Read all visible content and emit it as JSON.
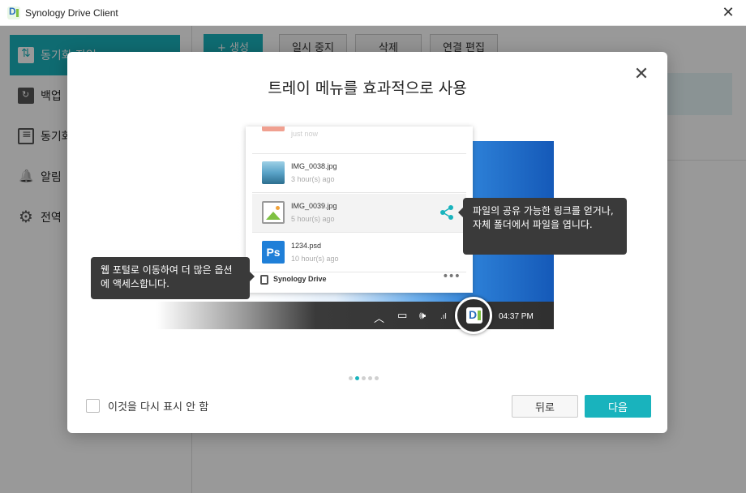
{
  "window": {
    "title": "Synology Drive Client",
    "close_glyph": "✕"
  },
  "sidebar": {
    "items": [
      {
        "label": "동기화 작업",
        "icon": "sync-icon"
      },
      {
        "label": "백업",
        "icon": "backup-folder-icon"
      },
      {
        "label": "동기화",
        "icon": "list-icon"
      },
      {
        "label": "알림",
        "icon": "bell-icon"
      },
      {
        "label": "전역",
        "icon": "gear-icon"
      }
    ]
  },
  "toolbar": {
    "create_label": "+ 생성",
    "pause_label": "일시 중지",
    "delete_label": "삭제",
    "edit_link_label": "연결 편집"
  },
  "modal": {
    "title": "트레이 메뉴를 효과적으로 사용",
    "close_glyph": "✕",
    "illustration": {
      "files": [
        {
          "name": "",
          "meta": "just now",
          "thumb": "red"
        },
        {
          "name": "IMG_0038.jpg",
          "meta": "3 hour(s) ago",
          "thumb": "sea"
        },
        {
          "name": "IMG_0039.jpg",
          "meta": "5 hour(s) ago",
          "thumb": "picture"
        },
        {
          "name": "1234.psd",
          "meta": "10 hour(s) ago",
          "thumb": "ps"
        }
      ],
      "ps_glyph": "Ps",
      "brand": "Synology Drive",
      "more_glyph": "•••",
      "clock": "04:37 PM",
      "tip_left": "웹 포털로 이동하여 더 많은 옵션에 액세스합니다.",
      "tip_right": "파일의 공유 가능한 링크를 얻거나, 자체 폴더에서 파일을 엽니다.",
      "accent_color": "#19b3bd"
    },
    "pager": {
      "count": 5,
      "active": 1
    },
    "dont_show_label": "이것을 다시 표시 안 함",
    "back_label": "뒤로",
    "next_label": "다음"
  }
}
